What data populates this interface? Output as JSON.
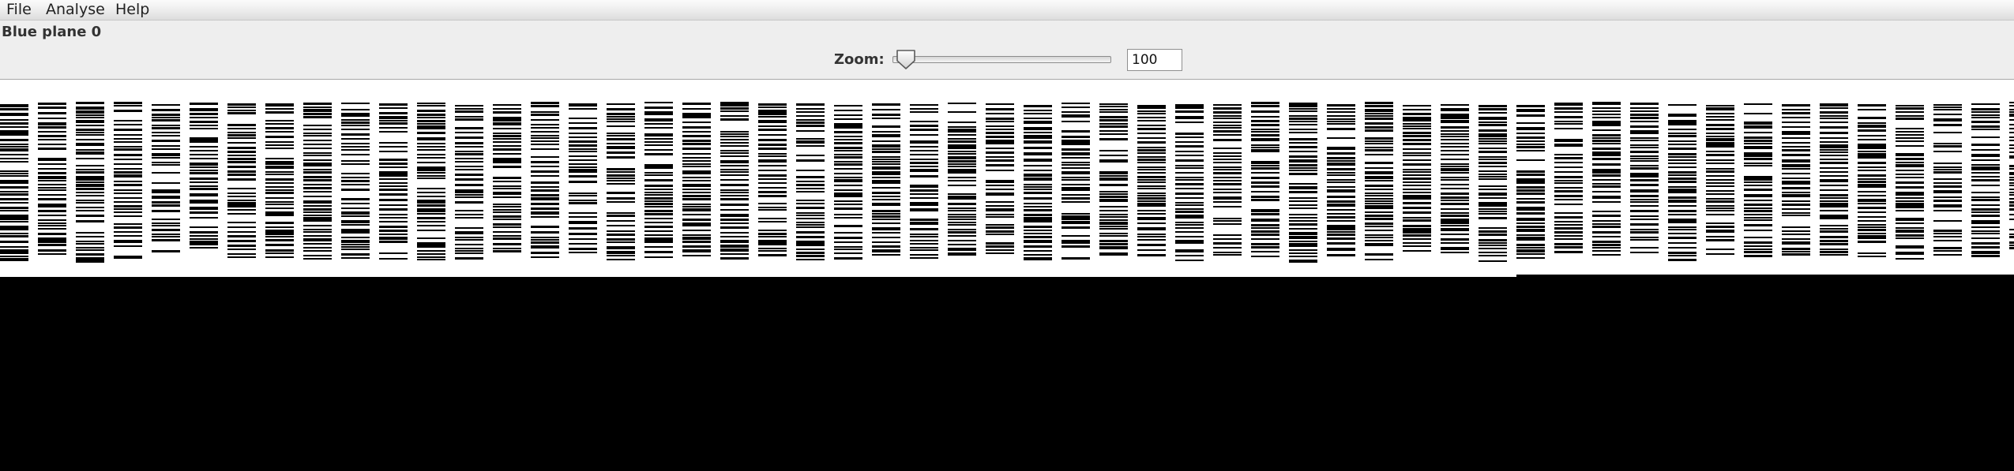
{
  "menu": {
    "items": [
      {
        "id": "file",
        "label": "File"
      },
      {
        "id": "analyse",
        "label": "Analyse"
      },
      {
        "id": "help",
        "label": "Help"
      }
    ]
  },
  "plane": {
    "label": "Blue plane 0",
    "channel": "blue",
    "index": 0
  },
  "zoom": {
    "label": "Zoom:",
    "value": "100",
    "slider_fraction": 0.06
  },
  "colors": {
    "menubar": "#ececec",
    "background": "#eeeeee",
    "image_ink": "#000000",
    "image_paper": "#ffffff",
    "viewer_bg": "#000000"
  },
  "icons": {
    "slider_thumb": "pentagon-thumb"
  }
}
